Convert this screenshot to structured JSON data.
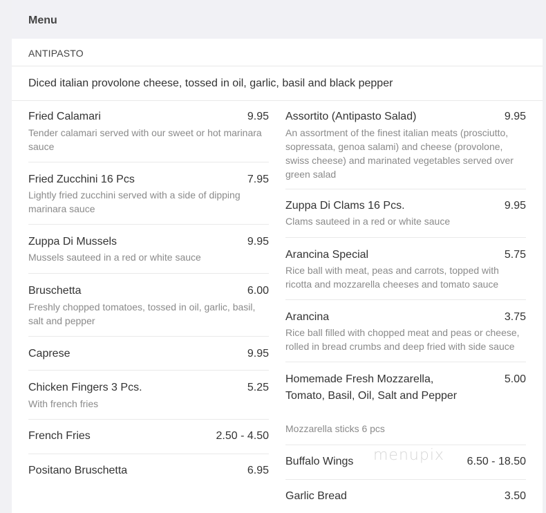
{
  "menu": {
    "title": "Menu"
  },
  "section": {
    "title": "ANTIPASTO",
    "description": "Diced italian provolone cheese, tossed in oil, garlic, basil and black pepper"
  },
  "left_items": [
    {
      "name": "Fried Calamari",
      "price": "9.95",
      "desc": "Tender calamari served with our sweet or hot marinara sauce"
    },
    {
      "name": "Fried Zucchini 16 Pcs",
      "price": "7.95",
      "desc": "Lightly fried zucchini served with a side of dipping marinara sauce"
    },
    {
      "name": "Zuppa Di Mussels",
      "price": "9.95",
      "desc": "Mussels sauteed in a red or white sauce"
    },
    {
      "name": "Bruschetta",
      "price": "6.00",
      "desc": "Freshly chopped tomatoes, tossed in oil, garlic, basil, salt and pepper"
    },
    {
      "name": "Caprese",
      "price": "9.95",
      "desc": ""
    },
    {
      "name": "Chicken Fingers 3 Pcs.",
      "price": "5.25",
      "desc": "With french fries"
    },
    {
      "name": "French Fries",
      "price": "2.50 - 4.50",
      "desc": ""
    },
    {
      "name": "Positano Bruschetta",
      "price": "6.95",
      "desc": ""
    }
  ],
  "right_items": [
    {
      "name": "Assortito (Antipasto Salad)",
      "price": "9.95",
      "desc": "An assortment of the finest italian meats (prosciutto, sopressata, genoa salami) and cheese (provolone, swiss cheese) and marinated vegetables served over green salad"
    },
    {
      "name": "Zuppa Di Clams 16 Pcs.",
      "price": "9.95",
      "desc": "Clams sauteed in a red or white sauce"
    },
    {
      "name": "Arancina Special",
      "price": "5.75",
      "desc": "Rice ball with meat, peas and carrots, topped with ricotta and mozzarella cheeses and tomato sauce"
    },
    {
      "name": "Arancina",
      "price": "3.75",
      "desc": "Rice ball filled with chopped meat and peas or cheese, rolled in bread crumbs and deep fried with side sauce"
    },
    {
      "name": "Homemade Fresh Mozzarella, Tomato, Basil, Oil, Salt and Pepper",
      "price": "5.00",
      "desc": "Mozzarella sticks 6 pcs"
    },
    {
      "name": "Buffalo Wings",
      "price": "6.50 - 18.50",
      "desc": ""
    },
    {
      "name": "Garlic Bread",
      "price": "3.50",
      "desc": ""
    }
  ],
  "watermark": "menupix"
}
